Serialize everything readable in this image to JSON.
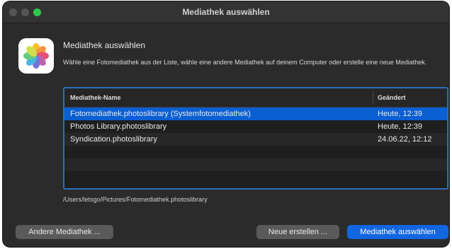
{
  "window": {
    "title": "Mediathek auswählen"
  },
  "dialog": {
    "heading": "Mediathek auswählen",
    "description": "Wähle eine Fotomediathek aus der Liste, wähle eine andere Mediathek auf deinem Computer oder erstelle eine neue Mediathek.",
    "app_icon": "photos-app-icon"
  },
  "table": {
    "columns": [
      "Mediathek-Name",
      "Geändert"
    ],
    "rows": [
      {
        "name": "Fotomediathek.photoslibrary (Systemfotomediathek)",
        "modified": "Heute, 12:39",
        "selected": true
      },
      {
        "name": "Photos Library.photoslibrary",
        "modified": "Heute, 12:39",
        "selected": false
      },
      {
        "name": "Syndication.photoslibrary",
        "modified": "24.06.22, 12:12",
        "selected": false
      }
    ]
  },
  "path": "/Users/letsgo/Pictures/Fotomediathek.photoslibrary",
  "buttons": {
    "other": "Andere Mediathek ...",
    "create": "Neue erstellen ...",
    "choose": "Mediathek auswählen"
  },
  "colors": {
    "selection": "#0a5fd2",
    "primary_button": "#1266e0",
    "focus_ring": "#2a6fb8"
  }
}
